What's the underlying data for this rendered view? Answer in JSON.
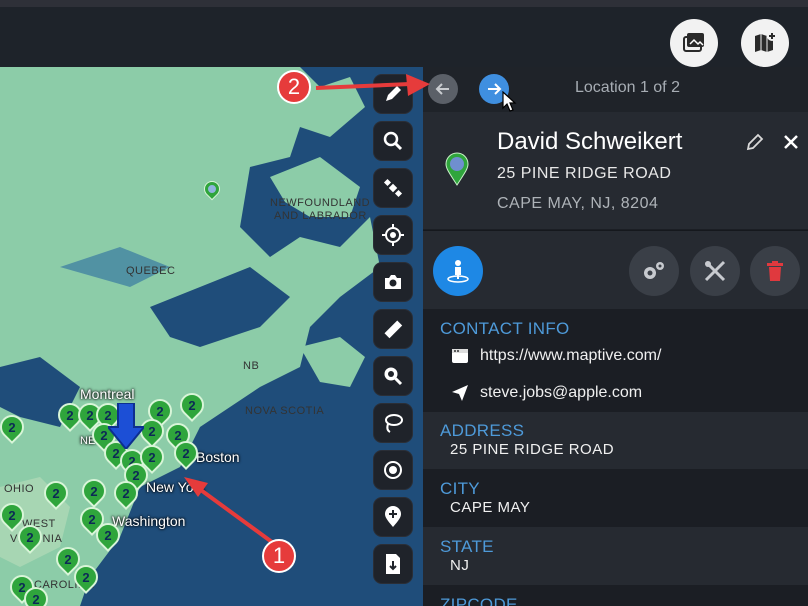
{
  "topbar": {
    "gallery_icon": "images-icon",
    "addmap_icon": "map-plus-icon"
  },
  "map": {
    "labels": {
      "newfoundland_1": "NEWFOUNDLAND",
      "newfoundland_2": "AND LABRADOR",
      "quebec": "QUEBEC",
      "nb": "NB",
      "nova_scotia": "NOVA SCOTIA",
      "ohio": "OHIO",
      "west": "WEST",
      "virginia": "VIRGINIA",
      "carolina": "CAROLINA"
    },
    "cities": {
      "montreal": "Montreal",
      "boston": "Boston",
      "new_york": "New York",
      "washington": "Washington",
      "new_short": "NEW"
    },
    "cluster_count": "2"
  },
  "toolbar": {
    "tools": [
      "pencil-icon",
      "search-icon",
      "satellite-icon",
      "crosshair-icon",
      "camera-icon",
      "ruler-icon",
      "zoom-search-icon",
      "lasso-icon",
      "target-icon",
      "add-location-icon",
      "export-icon"
    ]
  },
  "panel": {
    "nav": {
      "prev_icon": "arrow-left-icon",
      "next_icon": "arrow-right-icon",
      "location_text": "Location 1 of 2"
    },
    "record": {
      "name": "David Schweikert",
      "address": "25 PINE RIDGE ROAD",
      "city_line": "CAPE MAY, NJ, 8204"
    },
    "contact": {
      "title": "CONTACT INFO",
      "website": "https://www.maptive.com/",
      "email": "steve.jobs@apple.com"
    },
    "fields": [
      {
        "label": "ADDRESS",
        "value": "25 PINE RIDGE ROAD"
      },
      {
        "label": "CITY",
        "value": "CAPE MAY"
      },
      {
        "label": "STATE",
        "value": "NJ"
      },
      {
        "label": "ZIPCODE",
        "value": ""
      }
    ]
  },
  "annotations": {
    "badge1": "1",
    "badge2": "2"
  },
  "colors": {
    "accent_blue": "#1e88e5",
    "section_blue": "#4e9ad9",
    "annotation_red": "#e63b3b",
    "pin_green": "#2fa53c",
    "delete_red": "#e0393e"
  }
}
